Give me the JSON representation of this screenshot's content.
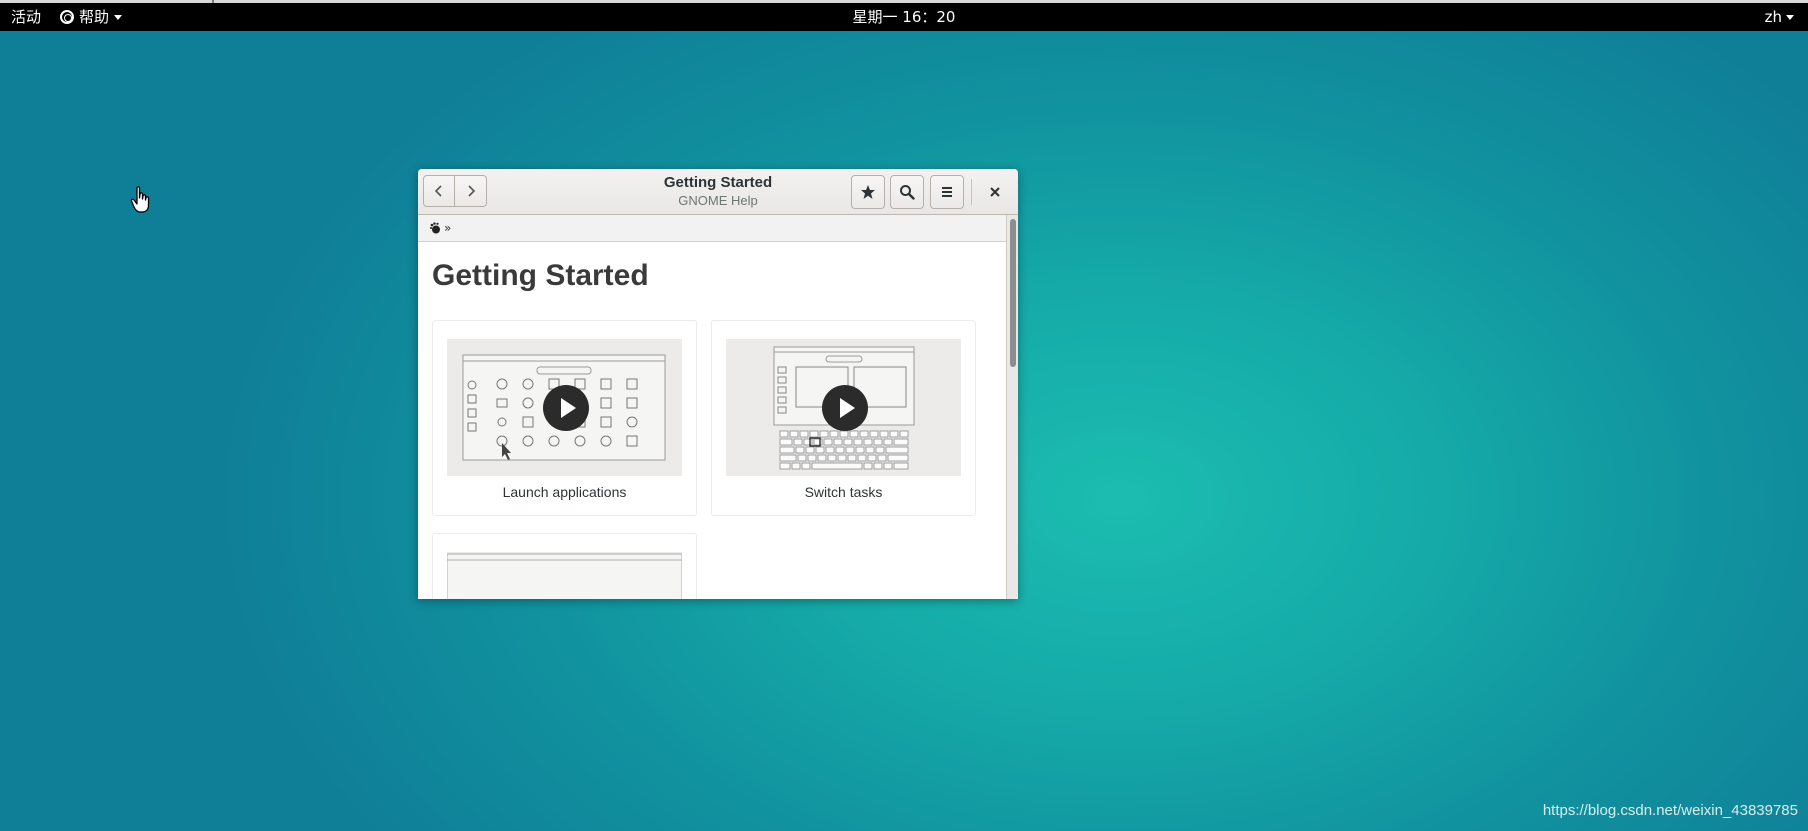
{
  "topbar": {
    "activities": "活动",
    "app_menu": "帮助",
    "clock": "星期一 16：20",
    "language": "zh"
  },
  "window": {
    "title": "Getting Started",
    "subtitle": "GNOME Help",
    "breadcrumb_sep": "»",
    "page_title": "Getting Started",
    "cards": [
      {
        "label": "Launch applications"
      },
      {
        "label": "Switch tasks"
      }
    ]
  },
  "watermark": "https://blog.csdn.net/weixin_43839785",
  "colors": {
    "desktop_center": "#1cbdb0",
    "desktop_edge": "#0f7f98",
    "topbar": "#000000"
  }
}
